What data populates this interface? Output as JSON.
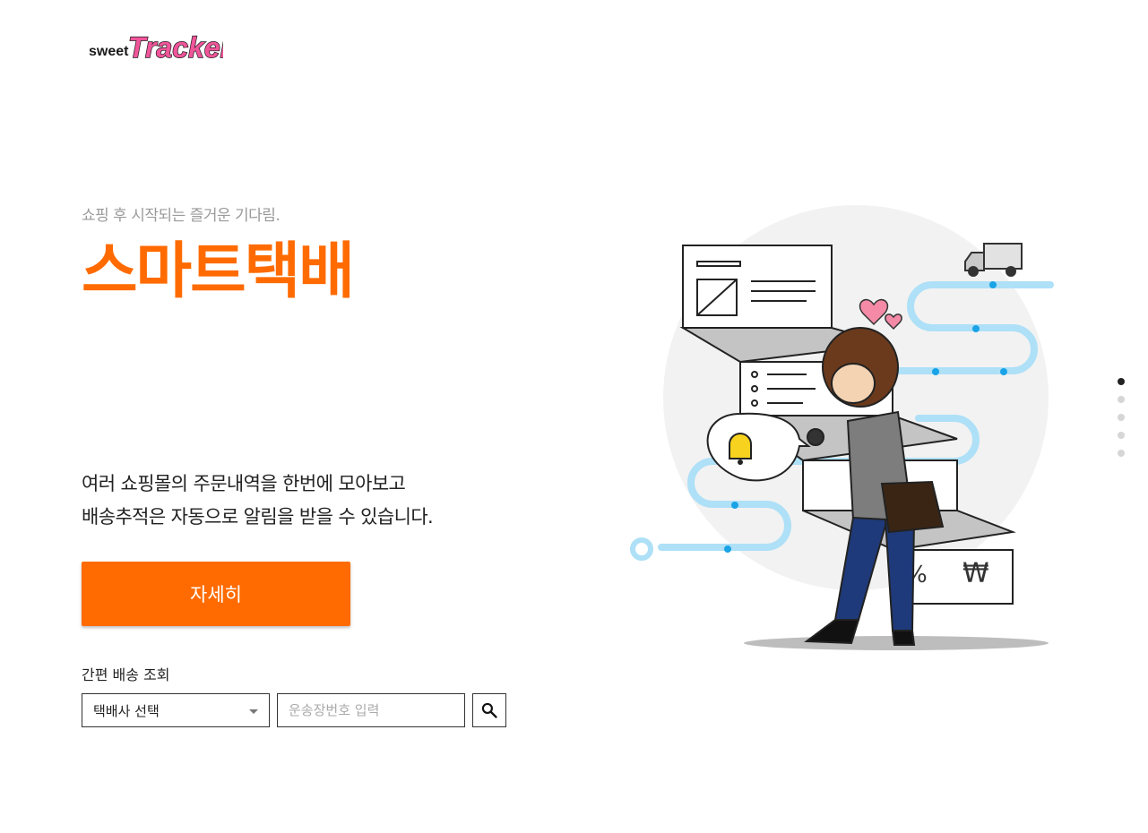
{
  "logo": {
    "prefix": "sweet",
    "main": "Tracker"
  },
  "hero": {
    "subtitle": "쇼핑 후 시작되는 즐거운 기다림.",
    "headline": "스마트택배",
    "description_line1": "여러 쇼핑몰의 주문내역을 한번에 모아보고",
    "description_line2": "배송추적은 자동으로 알림을 받을 수 있습니다.",
    "detail_button": "자세히"
  },
  "quick_search": {
    "label": "간편 배송 조회",
    "courier_select_value": "택배사 선택",
    "tracking_placeholder": "운송장번호 입력",
    "search_icon": "search-icon"
  },
  "page_indicator": {
    "count": 5,
    "active_index": 0
  },
  "illustration": {
    "sign_percent": "%",
    "sign_won": "₩"
  },
  "colors": {
    "accent": "#ff6b00",
    "logo_pink": "#f0559a",
    "route_blue": "#aee0f7",
    "route_dot": "#1aa3e6"
  }
}
